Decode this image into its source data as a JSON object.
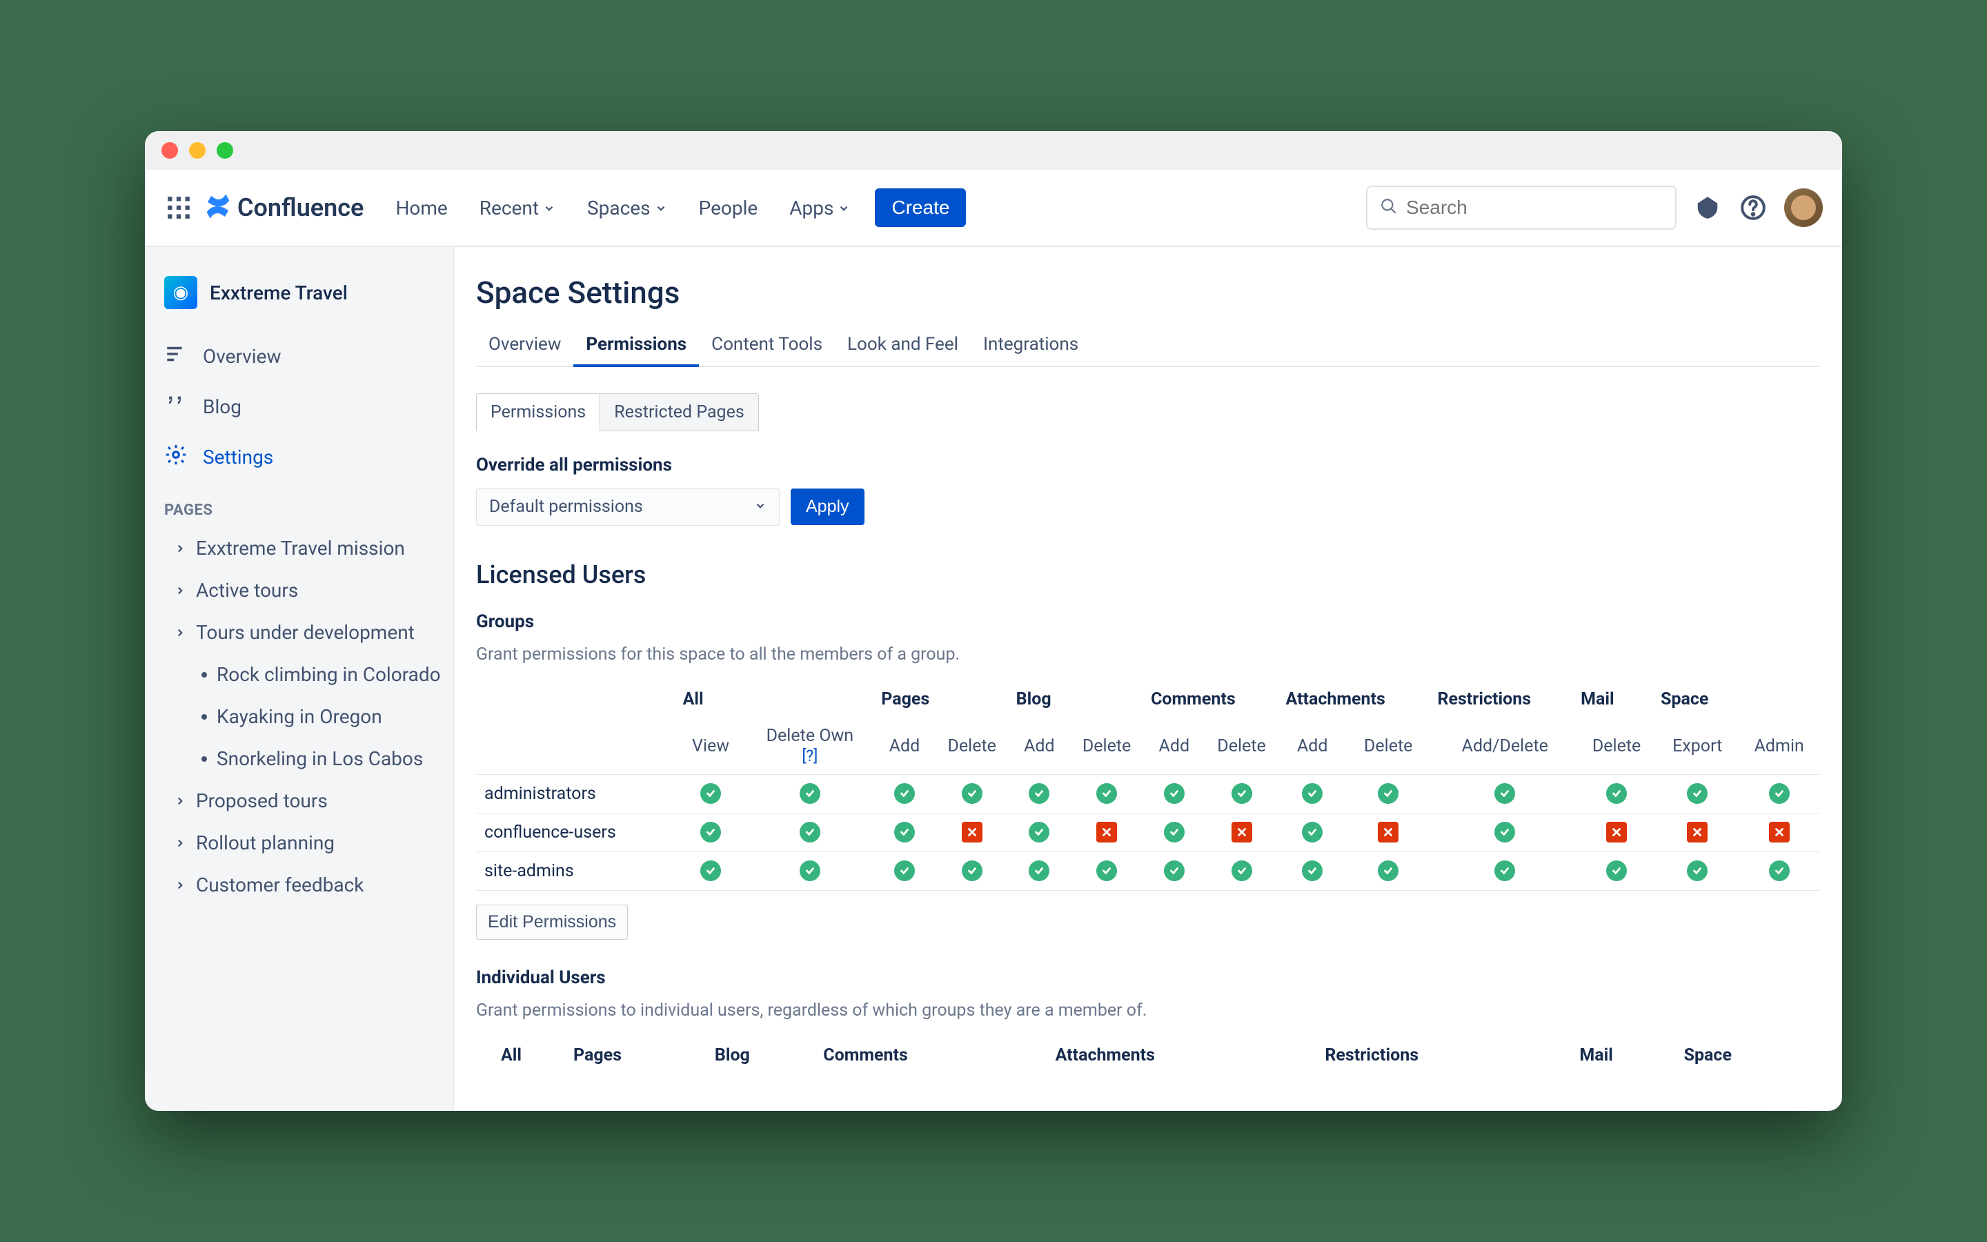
{
  "app": {
    "name": "Confluence"
  },
  "nav": {
    "items": [
      "Home",
      "Recent",
      "Spaces",
      "People",
      "Apps"
    ],
    "create": "Create",
    "search_placeholder": "Search"
  },
  "sidebar": {
    "space": "Exxtreme Travel",
    "items": [
      {
        "label": "Overview",
        "icon": "overview"
      },
      {
        "label": "Blog",
        "icon": "blog"
      },
      {
        "label": "Settings",
        "icon": "gear",
        "active": true
      }
    ],
    "pages_header": "PAGES",
    "tree": [
      {
        "label": "Exxtreme Travel mission"
      },
      {
        "label": "Active tours"
      },
      {
        "label": "Tours under development",
        "children": [
          "Rock climbing in Colorado",
          "Kayaking in Oregon",
          "Snorkeling in Los Cabos"
        ]
      },
      {
        "label": "Proposed tours"
      },
      {
        "label": "Rollout planning"
      },
      {
        "label": "Customer feedback"
      }
    ]
  },
  "page": {
    "title": "Space Settings",
    "tabs": [
      "Overview",
      "Permissions",
      "Content Tools",
      "Look and Feel",
      "Integrations"
    ],
    "active_tab": "Permissions",
    "subtabs": [
      "Permissions",
      "Restricted Pages"
    ],
    "active_subtab": "Permissions",
    "override": {
      "heading": "Override all permissions",
      "select": "Default permissions",
      "apply": "Apply"
    },
    "licensed_users": "Licensed Users",
    "groups": {
      "heading": "Groups",
      "desc": "Grant permissions for this space to all the members of a group.",
      "col_groups": [
        "All",
        "Pages",
        "Blog",
        "Comments",
        "Attachments",
        "Restrictions",
        "Mail",
        "Space"
      ],
      "sub_cols": {
        "all": [
          "View",
          "Delete Own"
        ],
        "pages": [
          "Add",
          "Delete"
        ],
        "blog": [
          "Add",
          "Delete"
        ],
        "comments": [
          "Add",
          "Delete"
        ],
        "attachments": [
          "Add",
          "Delete"
        ],
        "restrictions": [
          "Add/Delete"
        ],
        "mail": [
          "Delete"
        ],
        "space": [
          "Export",
          "Admin"
        ]
      },
      "help": "[?]",
      "rows": [
        {
          "name": "administrators",
          "perms": [
            true,
            true,
            true,
            true,
            true,
            true,
            true,
            true,
            true,
            true,
            true,
            true,
            true,
            true
          ]
        },
        {
          "name": "confluence-users",
          "perms": [
            true,
            true,
            true,
            false,
            true,
            false,
            true,
            false,
            true,
            false,
            true,
            false,
            false,
            false
          ]
        },
        {
          "name": "site-admins",
          "perms": [
            true,
            true,
            true,
            true,
            true,
            true,
            true,
            true,
            true,
            true,
            true,
            true,
            true,
            true
          ]
        }
      ],
      "edit": "Edit Permissions"
    },
    "individuals": {
      "heading": "Individual Users",
      "desc": "Grant permissions to individual users, regardless of which groups they are a member of.",
      "col_groups": [
        "All",
        "Pages",
        "Blog",
        "Comments",
        "Attachments",
        "Restrictions",
        "Mail",
        "Space"
      ]
    }
  }
}
